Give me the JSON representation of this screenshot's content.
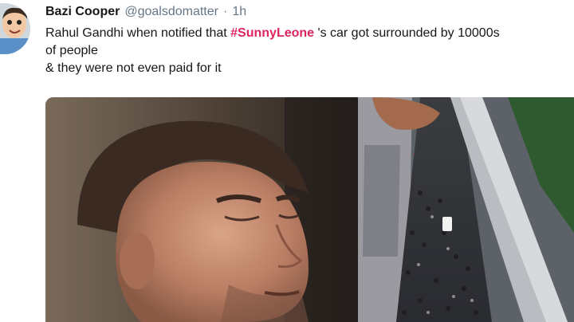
{
  "tweet": {
    "author_name": "Bazi Cooper",
    "author_handle": "@goalsdomatter",
    "separator": "·",
    "time": "1h",
    "text_before": "Rahul Gandhi when notified that ",
    "hashtag": "#SunnyLeone",
    "text_after": " 's car got surrounded by 10000s",
    "line2": "of people",
    "line3": "& they were not even paid for it"
  },
  "icons": {
    "avatar": "cartoon-avatar-icon"
  }
}
